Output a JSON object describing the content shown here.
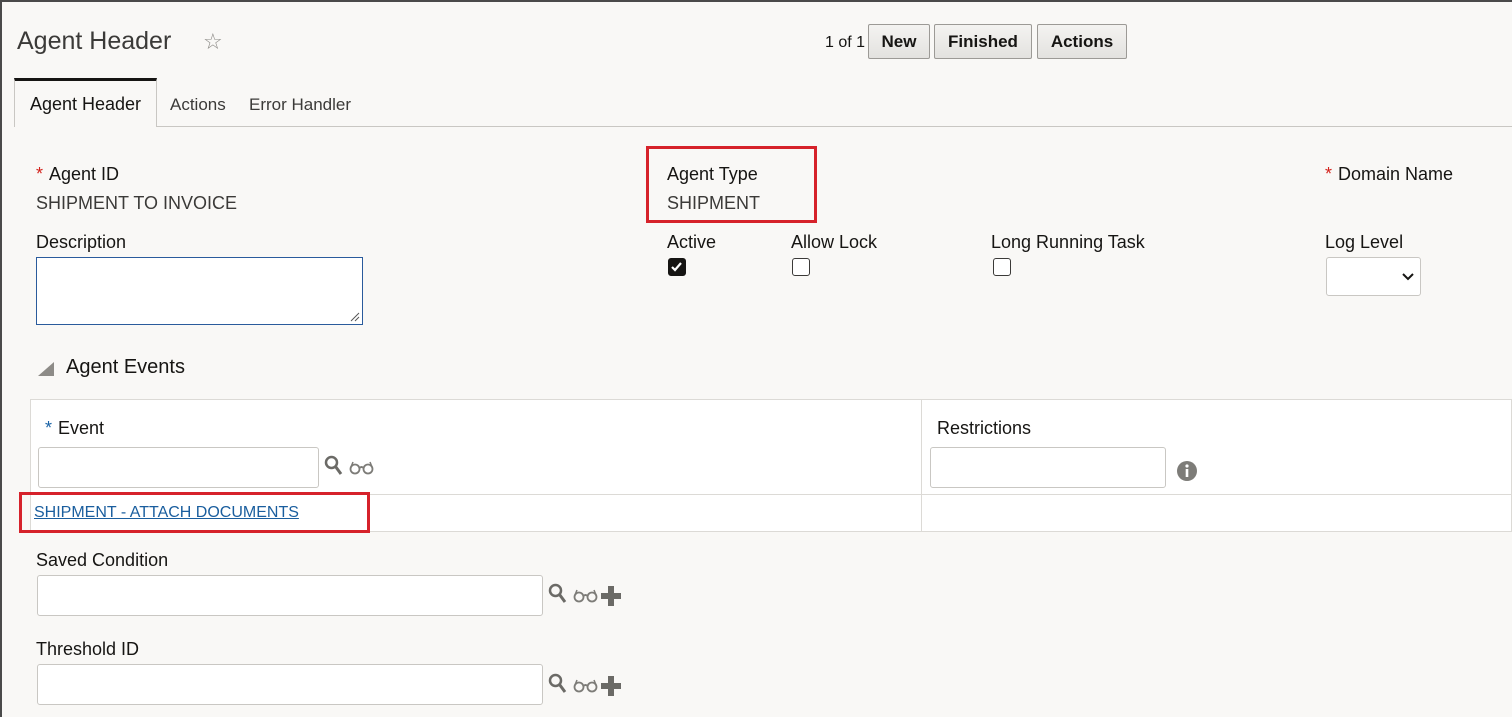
{
  "header": {
    "title": "Agent Header",
    "pager": "1 of 1",
    "buttons": {
      "new": "New",
      "finished": "Finished",
      "actions": "Actions"
    }
  },
  "tabs": [
    "Agent Header",
    "Actions",
    "Error Handler"
  ],
  "fields": {
    "agent_id_label": "Agent ID",
    "agent_id_value": "SHIPMENT TO INVOICE",
    "agent_type_label": "Agent Type",
    "agent_type_value": "SHIPMENT",
    "domain_name_label": "Domain Name",
    "description_label": "Description",
    "description_value": "",
    "active_label": "Active",
    "active_checked": true,
    "allow_lock_label": "Allow Lock",
    "allow_lock_checked": false,
    "long_running_label": "Long Running Task",
    "long_running_checked": false,
    "log_level_label": "Log Level",
    "log_level_value": "",
    "required_marker": "*"
  },
  "agent_events": {
    "section_title": "Agent Events",
    "event_label": "Event",
    "restrictions_label": "Restrictions",
    "event_input_value": "",
    "restrictions_input_value": "",
    "event_row_link": "SHIPMENT - ATTACH DOCUMENTS"
  },
  "conditions": {
    "saved_condition_label": "Saved Condition",
    "saved_condition_value": "",
    "threshold_id_label": "Threshold ID",
    "threshold_id_value": ""
  },
  "colors": {
    "highlight": "#d6222b",
    "required": "#d3221c",
    "link": "#1a5e9e"
  }
}
